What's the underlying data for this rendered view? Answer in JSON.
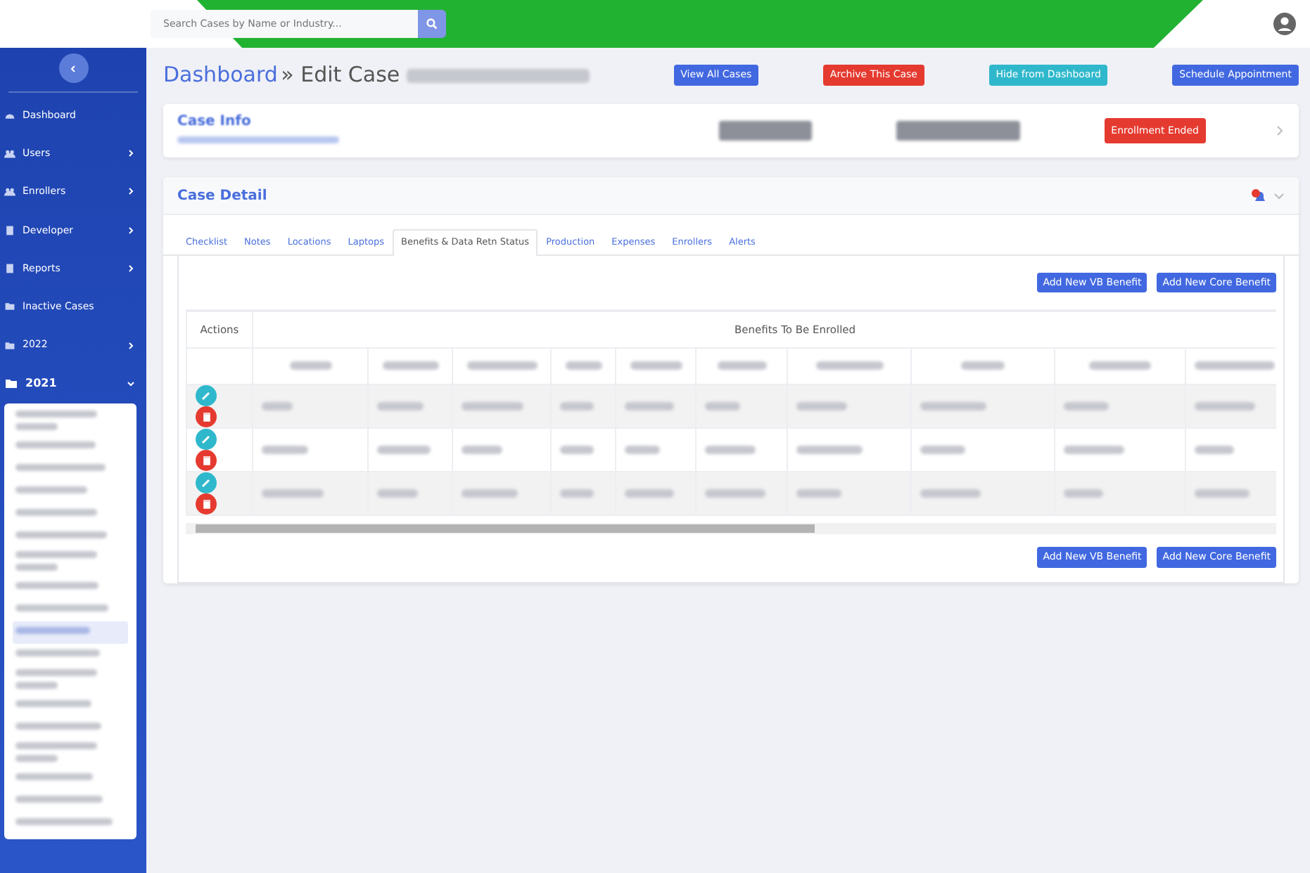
{
  "topbar": {
    "search": {
      "placeholder": "Search Cases by Name or Industry..."
    }
  },
  "sidebar": {
    "items": [
      {
        "label": "Dashboard",
        "has_children": false,
        "expanded": false
      },
      {
        "label": "Users",
        "has_children": true,
        "expanded": false
      },
      {
        "label": "Enrollers",
        "has_children": true,
        "expanded": false
      },
      {
        "label": "Developer",
        "has_children": true,
        "expanded": false
      },
      {
        "label": "Reports",
        "has_children": true,
        "expanded": false
      },
      {
        "label": "Inactive Cases",
        "has_children": false,
        "expanded": false
      },
      {
        "label": "2022",
        "has_children": true,
        "expanded": false
      },
      {
        "label": "2021",
        "has_children": true,
        "expanded": true,
        "children": [
          {
            "kind": "blurred-long",
            "selected": false
          },
          {
            "kind": "blurred",
            "selected": false
          },
          {
            "kind": "blurred",
            "selected": false
          },
          {
            "kind": "blurred",
            "selected": false
          },
          {
            "kind": "blurred",
            "selected": false
          },
          {
            "kind": "blurred",
            "selected": false
          },
          {
            "kind": "blurred-long",
            "selected": false
          },
          {
            "kind": "blurred",
            "selected": false
          },
          {
            "kind": "blurred",
            "selected": false
          },
          {
            "kind": "blurred",
            "selected": true
          },
          {
            "kind": "blurred",
            "selected": false
          },
          {
            "kind": "blurred-long",
            "selected": false
          },
          {
            "kind": "blurred",
            "selected": false
          },
          {
            "kind": "blurred",
            "selected": false
          },
          {
            "kind": "blurred-long",
            "selected": false
          },
          {
            "kind": "blurred",
            "selected": false
          },
          {
            "kind": "blurred",
            "selected": false
          },
          {
            "kind": "blurred",
            "selected": false
          }
        ]
      }
    ]
  },
  "header": {
    "breadcrumb_link": "Dashboard",
    "breadcrumb_text": "» Edit Case",
    "buttons": [
      {
        "label": "View All Cases"
      },
      {
        "label": "Archive This Case"
      },
      {
        "label": "Hide from Dashboard"
      },
      {
        "label": "Schedule Appointment"
      }
    ]
  },
  "case_info": {
    "title": "Case Info",
    "badges": [
      {
        "kind": "blurred"
      },
      {
        "kind": "blurred"
      },
      {
        "kind": "status",
        "label": "Enrollment Ended"
      }
    ]
  },
  "case_detail": {
    "title": "Case Detail",
    "tabs": [
      {
        "label": "Checklist",
        "selected": false
      },
      {
        "label": "Notes",
        "selected": false
      },
      {
        "label": "Locations",
        "selected": false
      },
      {
        "label": "Laptops",
        "selected": false
      },
      {
        "label": "Benefits & Data Retn Status",
        "selected": true
      },
      {
        "label": "Production",
        "selected": false
      },
      {
        "label": "Expenses",
        "selected": false
      },
      {
        "label": "Enrollers",
        "selected": false
      },
      {
        "label": "Alerts",
        "selected": false
      }
    ],
    "buttons_top": [
      "Add New VB Benefit",
      "Add New Core Benefit"
    ],
    "table": {
      "actions_header": "Actions",
      "group_header": "Benefits To Be Enrolled",
      "columns": [
        {
          "kind": "blurred"
        },
        {
          "kind": "blurred"
        },
        {
          "kind": "blurred"
        },
        {
          "kind": "blurred"
        },
        {
          "kind": "blurred"
        },
        {
          "kind": "blurred"
        },
        {
          "kind": "blurred"
        },
        {
          "kind": "blurred"
        },
        {
          "kind": "blurred"
        },
        {
          "kind": "blurred"
        }
      ],
      "rows": [
        {
          "striped": true
        },
        {
          "striped": false
        },
        {
          "striped": true
        }
      ]
    },
    "buttons_bottom": [
      "Add New VB Benefit",
      "Add New Core Benefit"
    ]
  }
}
